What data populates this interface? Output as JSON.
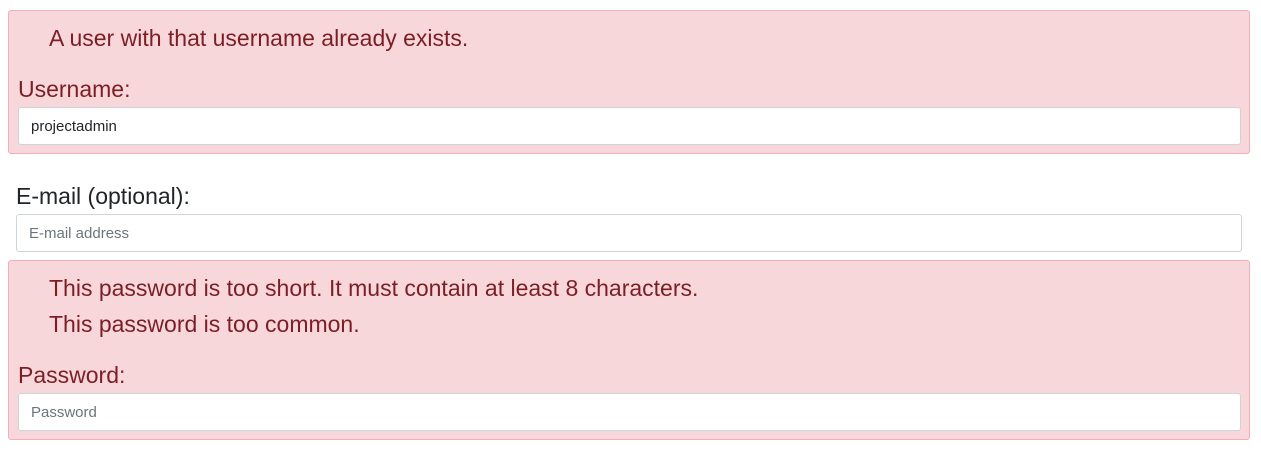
{
  "username_group": {
    "errors": [
      "A user with that username already exists."
    ],
    "label": "Username:",
    "value": "projectadmin"
  },
  "email_group": {
    "label": "E-mail (optional):",
    "placeholder": "E-mail address",
    "value": ""
  },
  "password_group": {
    "errors": [
      "This password is too short. It must contain at least 8 characters.",
      "This password is too common."
    ],
    "label": "Password:",
    "placeholder": "Password"
  },
  "colors": {
    "error_background": "#f8d7da",
    "error_text": "#7b1e26",
    "error_border": "#f1b0b7"
  }
}
